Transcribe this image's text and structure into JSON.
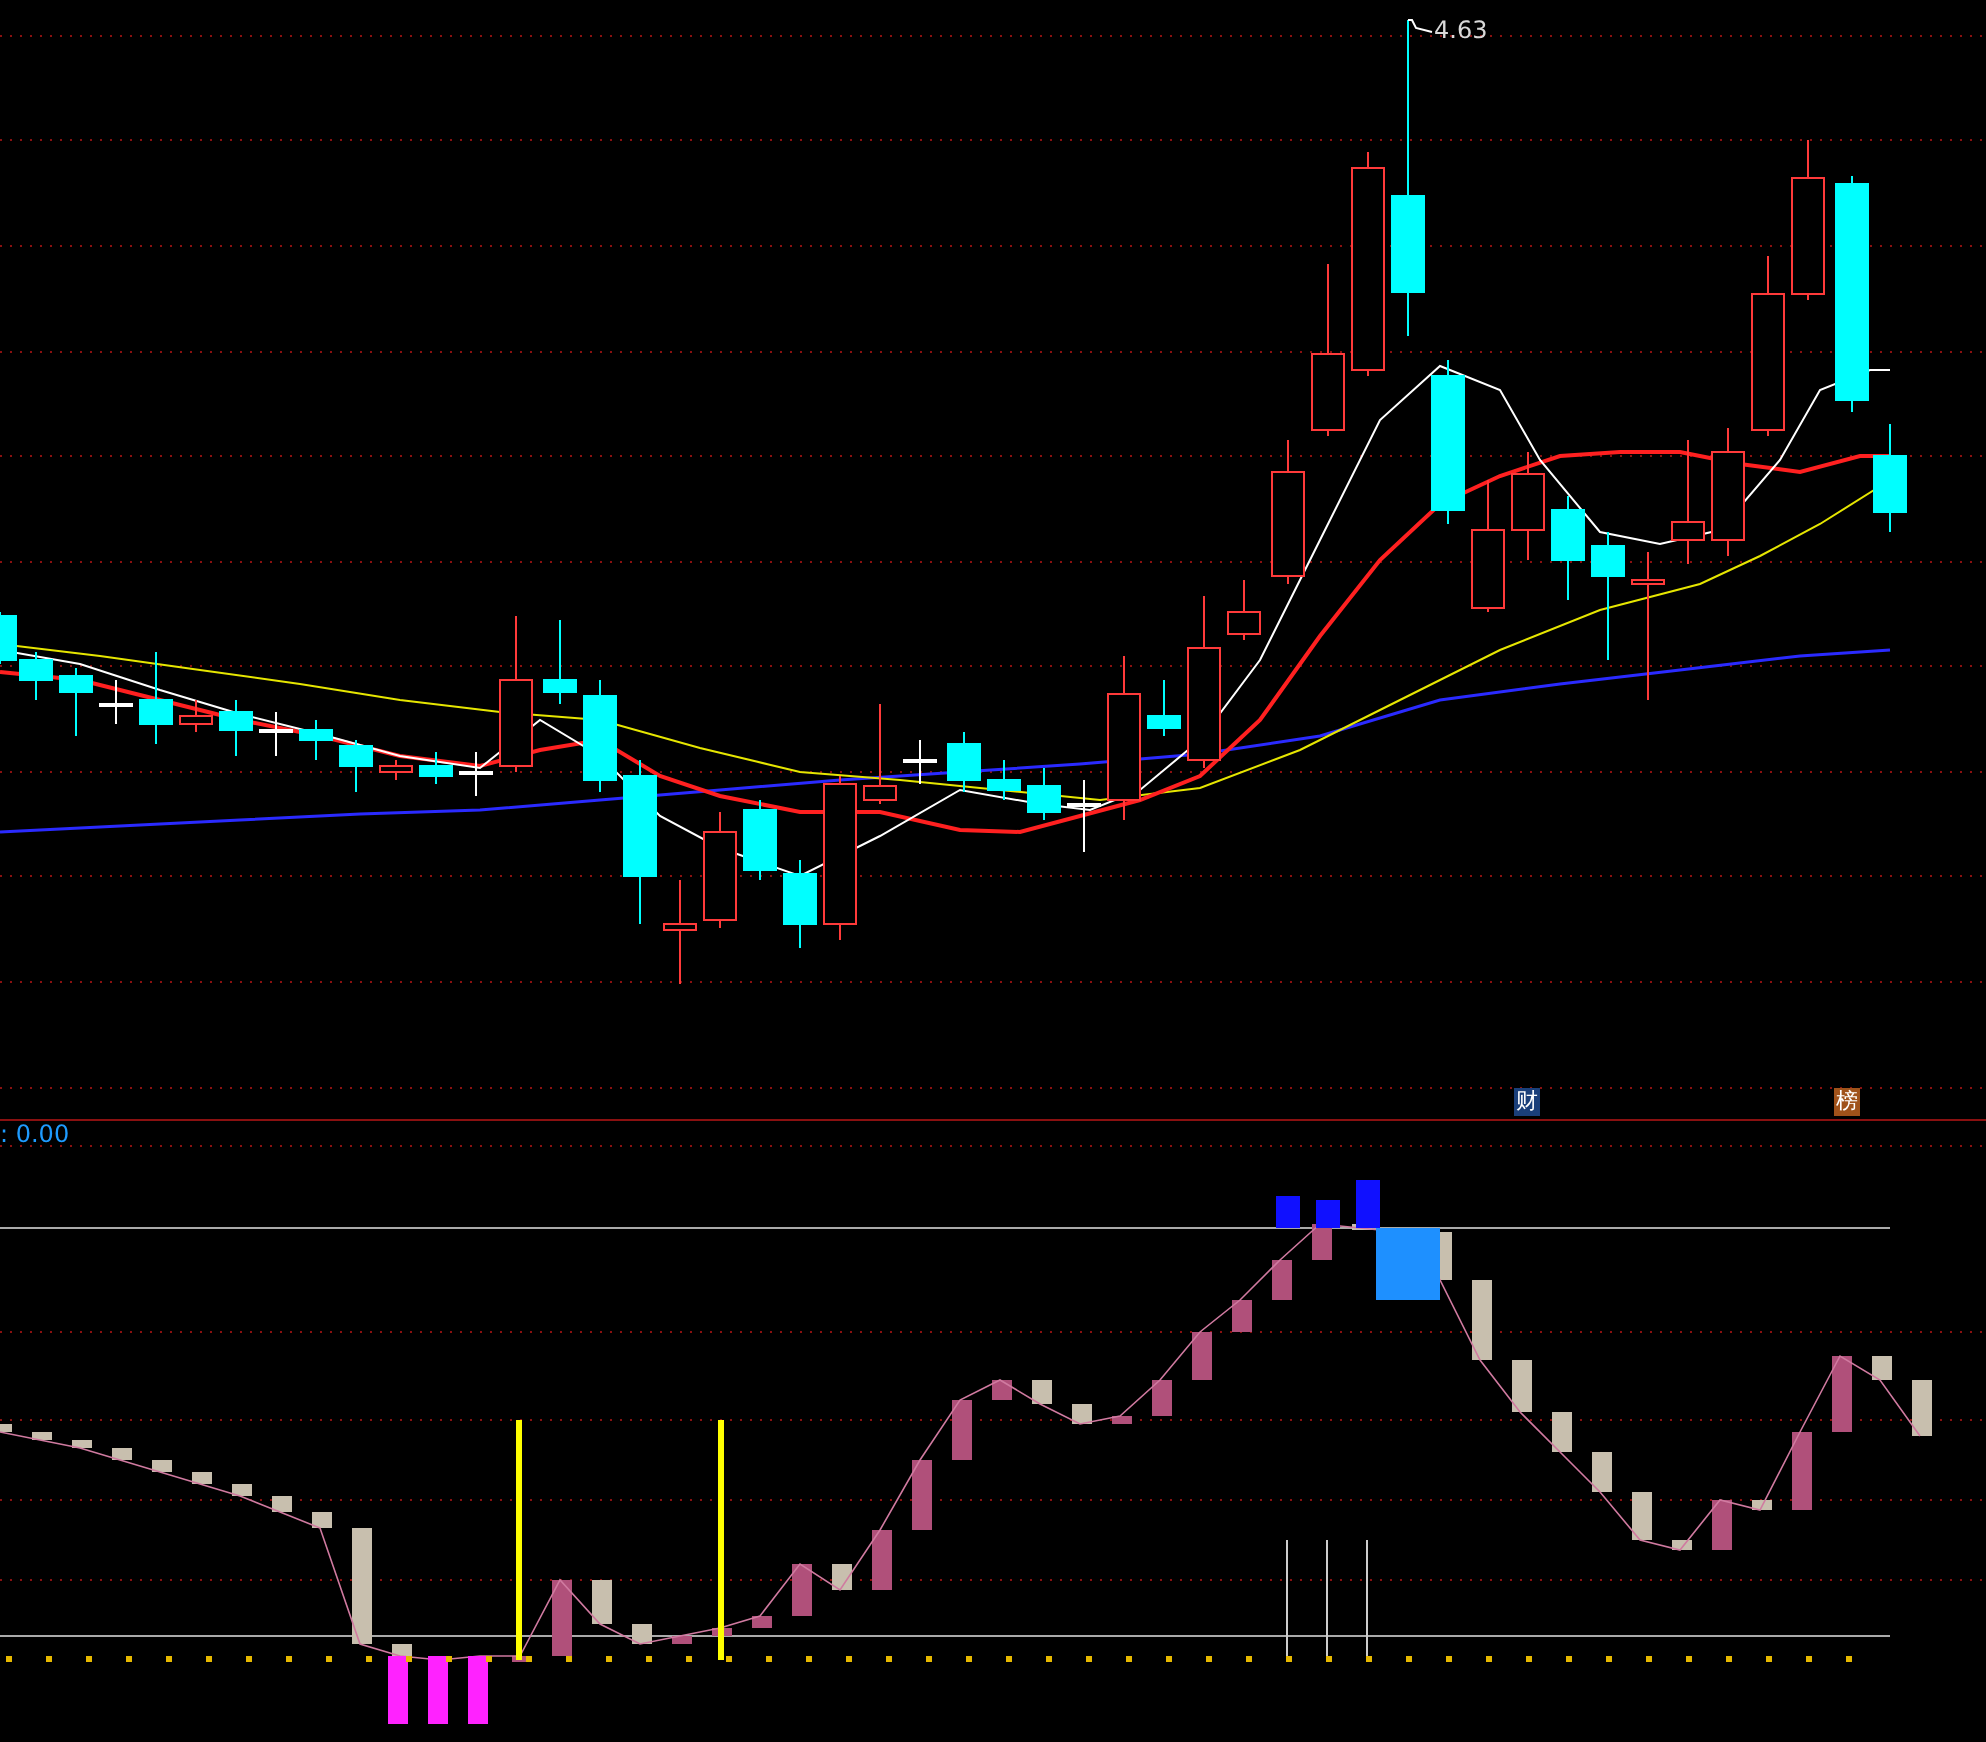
{
  "price_panel": {
    "high_label": "4.63",
    "markers": [
      {
        "text": "财",
        "color": "#1a3f7a"
      },
      {
        "text": "榜",
        "color": "#a0521a"
      }
    ]
  },
  "indicator_panel": {
    "value_label": ": 0.00"
  }
}
